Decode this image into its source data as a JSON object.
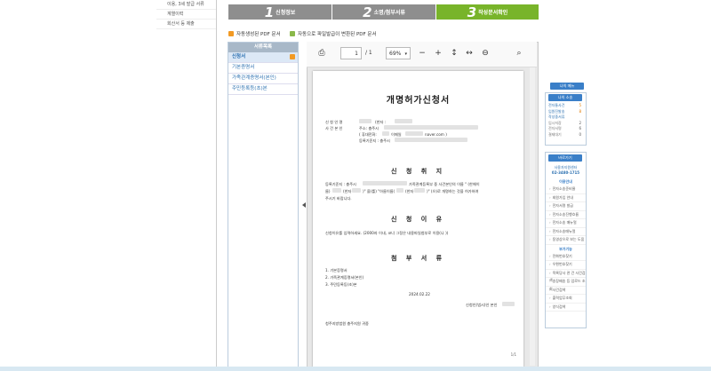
{
  "top_menu": {
    "items": [
      "이용, 3세 발급 서류",
      "계열이력",
      "회산서 등 제출"
    ]
  },
  "steps": [
    {
      "num": "1",
      "label": "신청정보"
    },
    {
      "num": "2",
      "label": "소명/첨부서류"
    },
    {
      "num": "3",
      "label": "작성문서확인"
    }
  ],
  "pdf_links": {
    "auto_pdf": "자동생성된 PDF 문서",
    "uploaded_pdf": "자동으로 파일발급이 변환된 PDF 문서"
  },
  "doclist": {
    "header": "서류목록",
    "items": [
      "신청서",
      "기본증명서",
      "가족관계증명서(본인)",
      "주민등록등(초)본"
    ]
  },
  "viewer": {
    "page_current": "1",
    "page_total": "/ 1",
    "zoom": "69%"
  },
  "document": {
    "title": "개명허가신청서",
    "applicant_label": "신 청 인 명",
    "applicant_label2": "사 건 본 인",
    "hanja": "(한자 :",
    "address": "주소: 충주시",
    "phone": "( 휴대전화:",
    "email": "이메일",
    "email_domain": "naver.com )",
    "reg": "등록기준지 : 충주시",
    "section1": "신 청 취 지",
    "purpose_line1": "등록기준지 : 충주시",
    "purpose_line1b": "가족관계등록부 중 사건본인의 이름 \" (한해이",
    "purpose_line2": "름)",
    "purpose_line2b": "(한자",
    "purpose_line2c": ")\" 을(를) \"아름이름(",
    "purpose_line2d": "(한자",
    "purpose_line2e": ")\" (으)로 개명하는 것을 허가하여",
    "purpose_line3": "주시기 바랍니다.",
    "section2": "신 청 이 유",
    "reason": "신청이유를 입력하세요. (2000자 이내, 코너 그정은 내용파일첨부로 이용(나 ))",
    "section3": "첨 부 서 류",
    "attachments": [
      "1.    기본증명서",
      "2.    가족관계증명서(본인)",
      "3.    주민등록등(초)본"
    ],
    "date": "2024.02.22",
    "signer": "신청인(법시)인 본인",
    "court": "청주지방법원 충주지원 귀중",
    "page_num": "1/1"
  },
  "right_sidebar": {
    "my_menu": "나의 메뉴",
    "my_status": "나의 소송",
    "status_rows": [
      {
        "label": "전자통사건",
        "value": "5"
      },
      {
        "label": "임원진발송",
        "value": "8"
      },
      {
        "label": "작성중서류",
        "value": ""
      },
      {
        "label": "임시저장",
        "value": "2"
      },
      {
        "label": "전자서명",
        "value": "6"
      },
      {
        "label": "결제대기",
        "value": "0"
      }
    ],
    "quick_btn": "바로가기",
    "contact_line1": "사용자지원센터",
    "contact_line2": "02-3480-1715",
    "guide_title": "이용안내",
    "guide_items": [
      "전자소송준비물",
      "회원가입 안내",
      "전자서명 발급",
      "전자소송진행흐름",
      "전자소송 매뉴얼",
      "전자소송매뉴얼",
      "동영상으로 보는 도움"
    ],
    "extra_title": "부가기능",
    "extra_items": [
      "전화번호찾기",
      "우편번호찾기",
      "목록당사 관 건 사건검색",
      "송장배송 등 업로드 조회",
      "사건검색",
      "출력업무조회",
      "양식검색"
    ]
  },
  "colors": {
    "step_inactive": "#8e8e8e",
    "step_active": "#78b42a",
    "accent_blue": "#3a7fc8",
    "badge_orange": "#f29a24"
  }
}
